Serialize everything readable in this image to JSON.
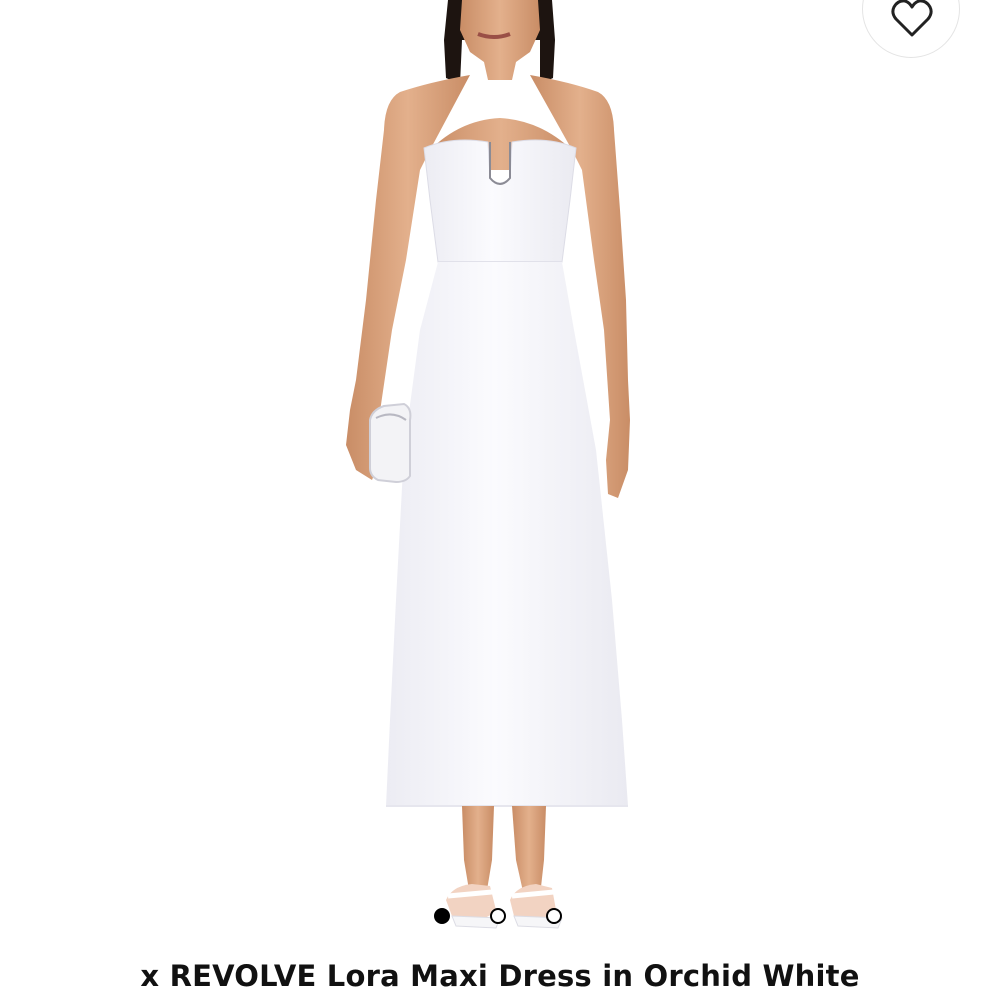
{
  "product": {
    "title": "x REVOLVE Lora Maxi Dress in Orchid White",
    "image_alt": "Model wearing strapless white maxi dress",
    "image_count": 3,
    "active_image_index": 0
  },
  "wishlist": {
    "icon": "heart-icon"
  },
  "colors": {
    "background": "#ffffff",
    "dress": "#f7f7fb",
    "skin": "#d9a27c",
    "hair": "#1d1410",
    "text": "#111111",
    "dot_active": "#000000"
  }
}
